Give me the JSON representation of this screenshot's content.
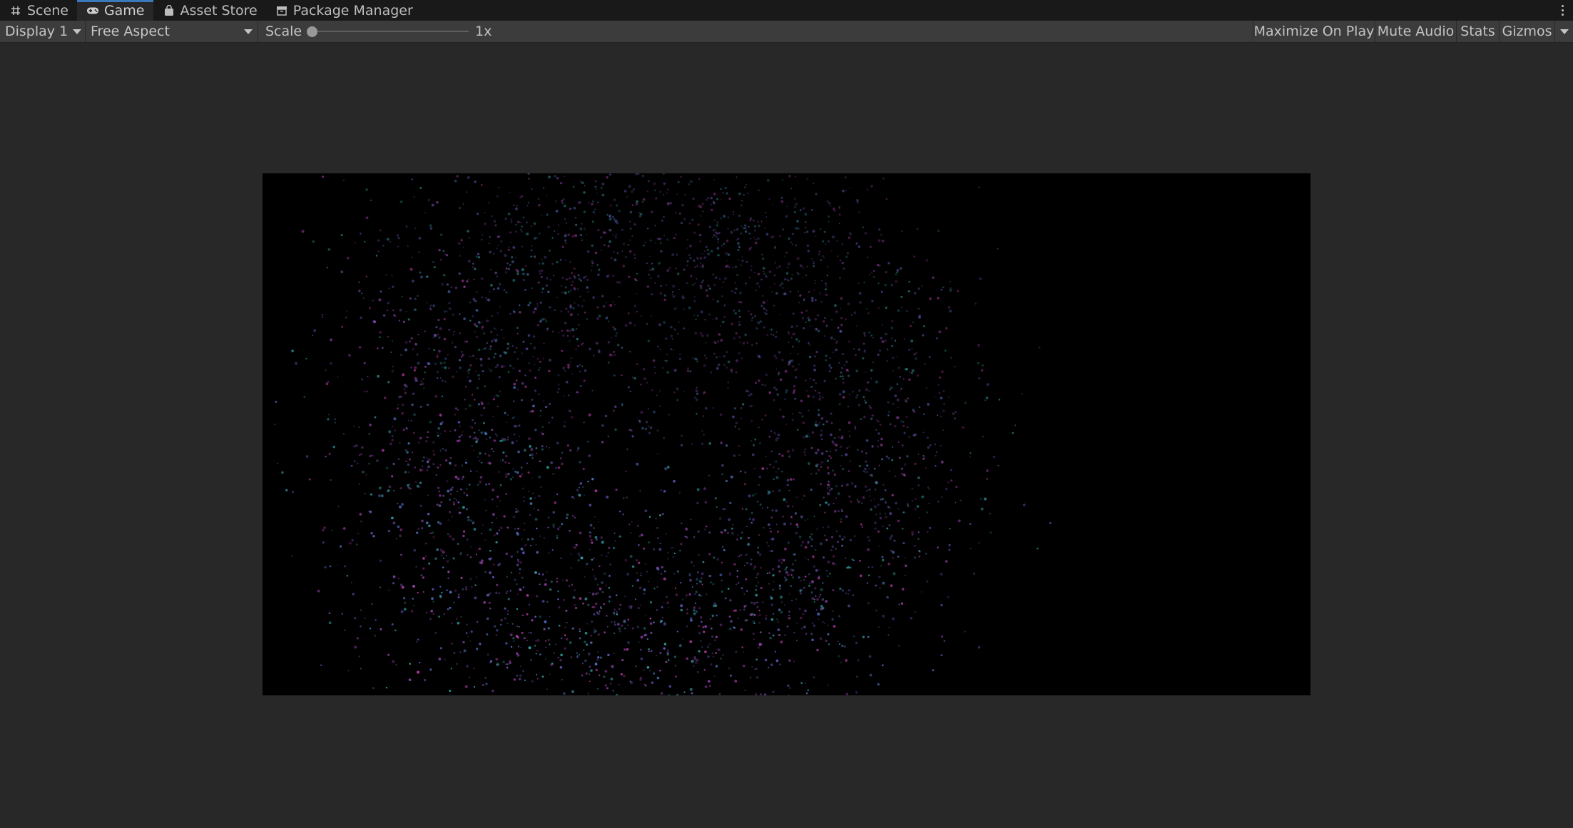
{
  "tabs": [
    {
      "label": "Scene",
      "icon": "grid-icon",
      "active": false
    },
    {
      "label": "Game",
      "icon": "gamepad-icon",
      "active": true
    },
    {
      "label": "Asset Store",
      "icon": "bag-icon",
      "active": false
    },
    {
      "label": "Package Manager",
      "icon": "package-icon",
      "active": false
    }
  ],
  "toolbar": {
    "display": "Display 1",
    "aspect": "Free Aspect",
    "scale_label": "Scale",
    "scale_value": "1x",
    "scale_level": 0.0,
    "maximize_on_play": "Maximize On Play",
    "mute_audio": "Mute Audio",
    "stats": "Stats",
    "gizmos": "Gizmos"
  },
  "game_view": {
    "background": "#000000",
    "particle_colors": [
      "#6a4fb8",
      "#8a3fa6",
      "#2f9aa0",
      "#b23aa8",
      "#4f6fc0"
    ]
  },
  "colors": {
    "tab_accent": "#3a79bb",
    "panel_bg": "#282828",
    "toolbar_bg": "#3c3c3c"
  }
}
